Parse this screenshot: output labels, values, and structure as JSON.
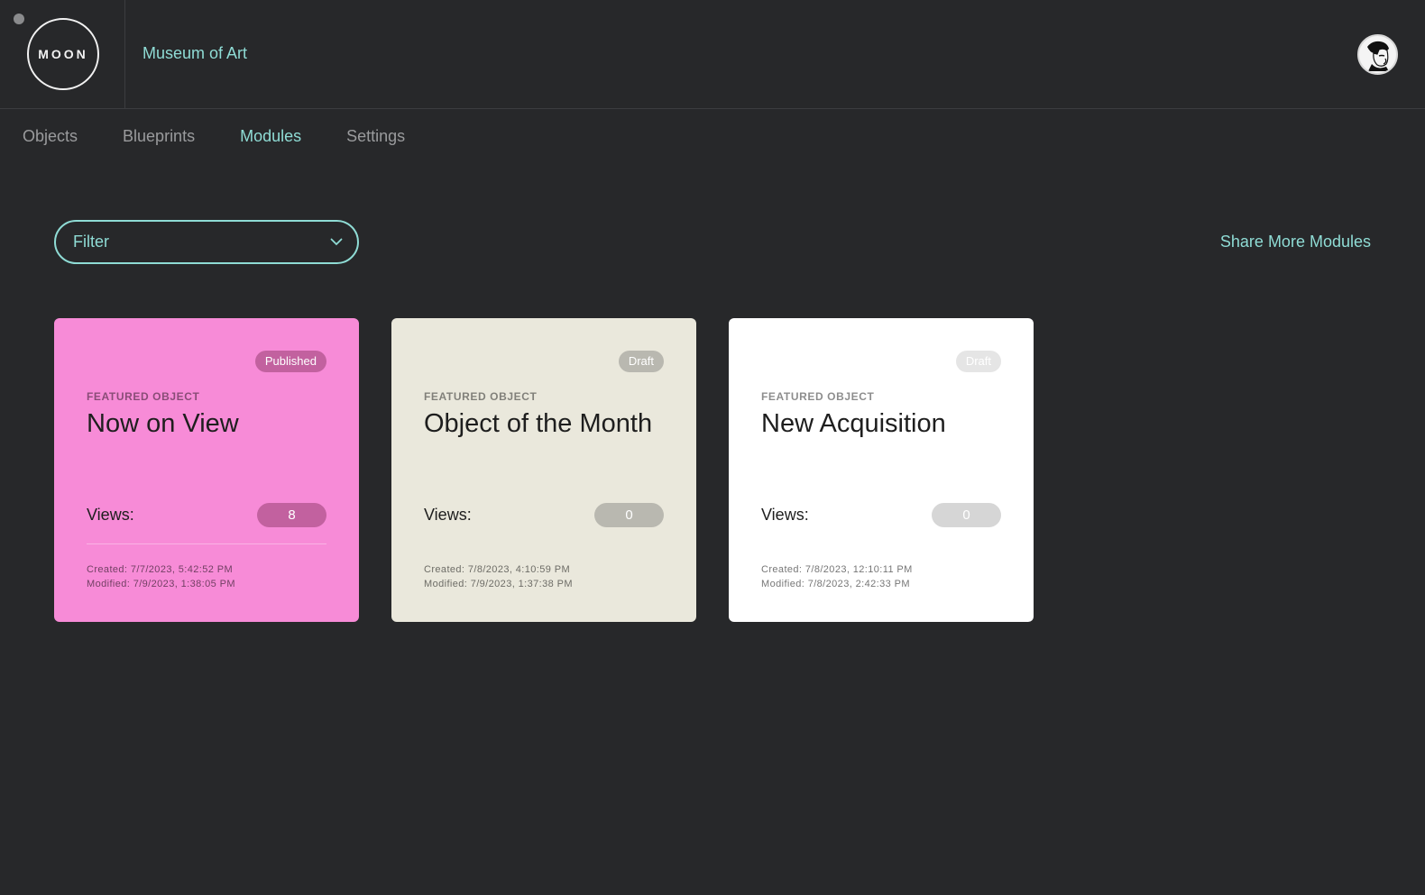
{
  "app": {
    "logo_text": "MOON",
    "org_name": "Museum of Art"
  },
  "nav": {
    "items": [
      {
        "label": "Objects",
        "active": false
      },
      {
        "label": "Blueprints",
        "active": false
      },
      {
        "label": "Modules",
        "active": true
      },
      {
        "label": "Settings",
        "active": false
      }
    ]
  },
  "toolbar": {
    "filter_label": "Filter",
    "share_label": "Share More Modules"
  },
  "modules": [
    {
      "status": "Published",
      "kicker": "FEATURED OBJECT",
      "title": "Now on View",
      "views_label": "Views:",
      "views": "8",
      "created": "Created: 7/7/2023, 5:42:52 PM",
      "modified": "Modified: 7/9/2023, 1:38:05 PM",
      "color": "#f78bd7"
    },
    {
      "status": "Draft",
      "kicker": "FEATURED OBJECT",
      "title": "Object of the Month",
      "views_label": "Views:",
      "views": "0",
      "created": "Created: 7/8/2023, 4:10:59 PM",
      "modified": "Modified: 7/9/2023, 1:37:38 PM",
      "color": "#eae8dc"
    },
    {
      "status": "Draft",
      "kicker": "FEATURED OBJECT",
      "title": "New Acquisition",
      "views_label": "Views:",
      "views": "0",
      "created": "Created: 7/8/2023, 12:10:11 PM",
      "modified": "Modified: 7/8/2023, 2:42:33 PM",
      "color": "#ffffff"
    }
  ],
  "colors": {
    "background": "#27282a",
    "accent": "#8fdcd5"
  }
}
